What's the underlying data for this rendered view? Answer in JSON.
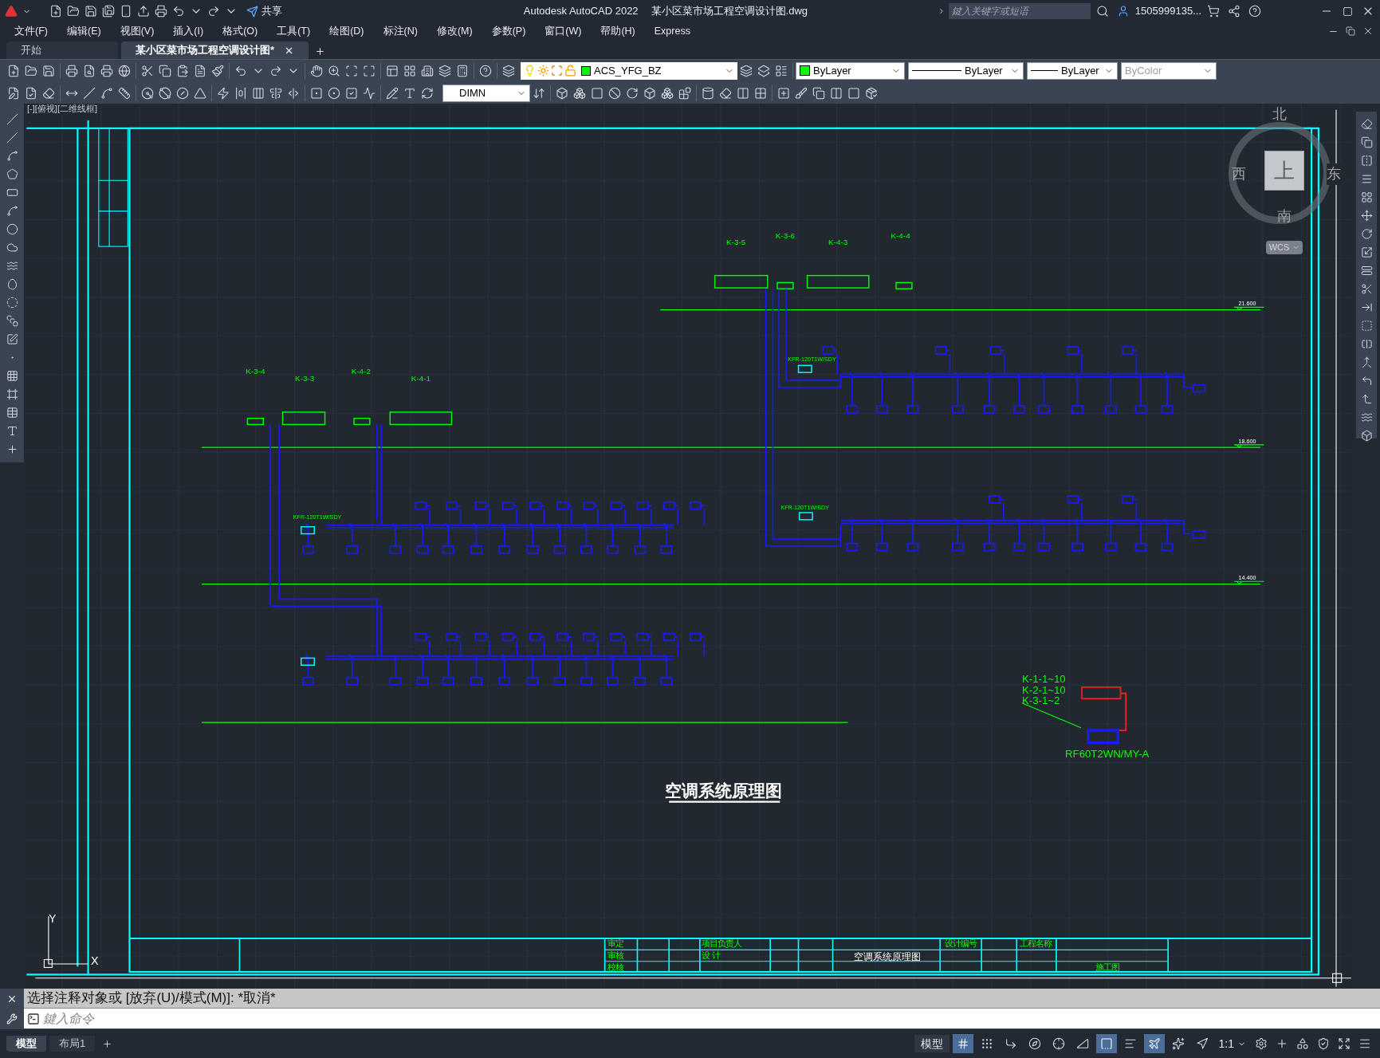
{
  "title_bar": {
    "app": "Autodesk AutoCAD 2022",
    "file": "某小区菜市场工程空调设计图.dwg",
    "share": "共享",
    "search": {
      "placeholder": "鍵入关键字或短语"
    },
    "user": "1505999135..."
  },
  "menu": [
    "文件(F)",
    "编辑(E)",
    "视图(V)",
    "插入(I)",
    "格式(O)",
    "工具(T)",
    "绘图(D)",
    "标注(N)",
    "修改(M)",
    "参数(P)",
    "窗口(W)",
    "帮助(H)",
    "Express"
  ],
  "doc_tabs": [
    {
      "label": "开始",
      "selected": false
    },
    {
      "label": "某小区菜市场工程空调设计图*",
      "selected": true
    }
  ],
  "toolbar": {
    "layer": {
      "name": "ACS_YFG_BZ",
      "color": "#00ff00"
    },
    "color": {
      "label": "ByLayer",
      "color": "#00ff00"
    },
    "linetype": "ByLayer",
    "lineweight": "ByLayer",
    "plot_style": {
      "label": "ByColor",
      "disabled": true
    },
    "dim_style": "DIMN"
  },
  "viewport_label": "[-][俯视][二维线框]",
  "view_cube": {
    "north": "北",
    "south": "南",
    "west": "西",
    "east": "东",
    "face": "上",
    "ucs": "WCS"
  },
  "drawing": {
    "unit_tags": [
      "K-3-5",
      "K-3-6",
      "K-4-3",
      "K-4-4",
      "K-3-4",
      "K-3-3",
      "K-4-2",
      "K-4-1"
    ],
    "model_labels": [
      "KFR-120T1W/SDY",
      "KFR-120T1W/SDY",
      "KFR-120T1W/SDY"
    ],
    "elevations": [
      "21.600",
      "18.600",
      "14.400"
    ],
    "legend": {
      "lines": [
        "K-1-1~10",
        "K-2-1~10",
        "K-3-1~2"
      ],
      "model": "RF60T2WN/MY-A"
    },
    "title": "空调系统原理图",
    "title_block": [
      "审定",
      "审核",
      "校核",
      "项目负责人",
      "设 计",
      "空调系统原理图",
      "设计编号",
      "工程名称",
      "施工图"
    ]
  },
  "ucs": {
    "y": "Y",
    "x": "X"
  },
  "command": {
    "history": "选择注释对象或 [放弃(U)/模式(M)]: *取消*",
    "placeholder": "鍵入命令"
  },
  "layout_tabs": [
    {
      "label": "模型",
      "selected": true
    },
    {
      "label": "布局1",
      "selected": false
    }
  ],
  "status": {
    "model": "模型",
    "scale": "1:1",
    "toggles": [
      {
        "kind": "grid",
        "on": true
      },
      {
        "kind": "snap",
        "on": false
      },
      {
        "kind": "ortho",
        "on": false
      },
      {
        "kind": "polar",
        "on": false
      },
      {
        "kind": "track",
        "on": false
      },
      {
        "kind": "angle",
        "on": false
      },
      {
        "kind": "osnap",
        "on": true
      },
      {
        "kind": "lineweight",
        "on": false
      },
      {
        "kind": "annotation",
        "on": true
      },
      {
        "kind": "autoscale",
        "on": false
      },
      {
        "kind": "annoscale",
        "on": false
      }
    ]
  }
}
